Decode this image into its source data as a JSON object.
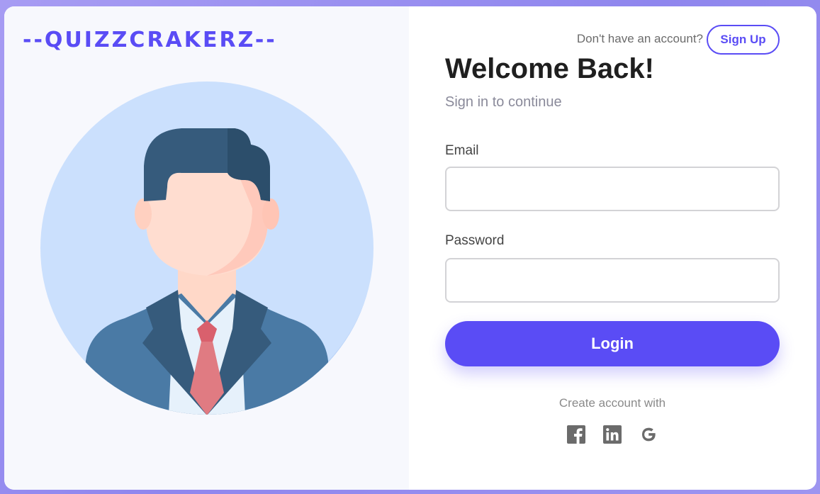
{
  "brand": {
    "name": "--QUIZZCRAKERZ--"
  },
  "header": {
    "signup_prompt": "Don't have an account?",
    "signup_label": "Sign Up"
  },
  "form": {
    "title": "Welcome Back!",
    "subtitle": "Sign in to continue",
    "email": {
      "label": "Email",
      "value": "",
      "placeholder": ""
    },
    "password": {
      "label": "Password",
      "value": "",
      "placeholder": ""
    },
    "login_label": "Login"
  },
  "social": {
    "caption": "Create account with",
    "providers": [
      {
        "icon": "facebook-icon"
      },
      {
        "icon": "linkedin-icon"
      },
      {
        "icon": "google-icon"
      }
    ]
  },
  "colors": {
    "accent": "#5a4cf5",
    "background_gradient_start": "#a79cf3",
    "left_panel": "#f7f8fd",
    "avatar_circle": "#cbe0fd",
    "suit": "#4a7aa5",
    "hair": "#365b7c",
    "tie": "#e07b82"
  }
}
